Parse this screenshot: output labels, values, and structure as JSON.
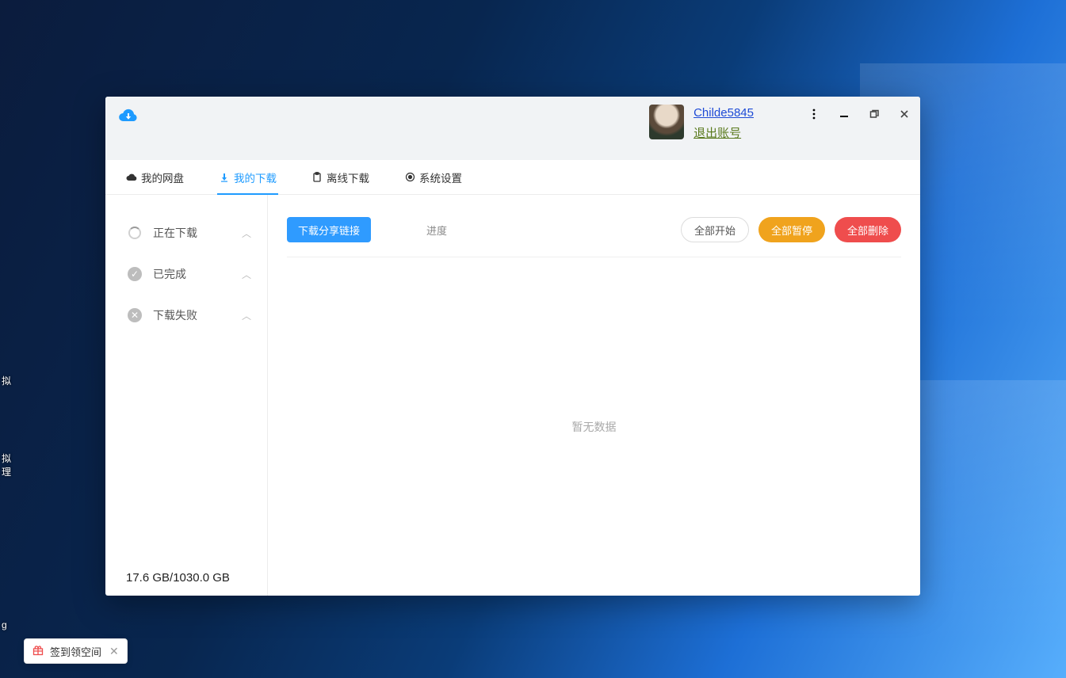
{
  "user": {
    "name": "Childe5845",
    "logout_label": "退出账号"
  },
  "tabs": {
    "disk": "我的网盘",
    "dl": "我的下载",
    "offline": "离线下载",
    "settings": "系统设置"
  },
  "side": {
    "downloading": "正在下载",
    "done": "已完成",
    "failed": "下载失败"
  },
  "toolbar": {
    "download_share": "下载分享链接",
    "progress": "进度",
    "start_all": "全部开始",
    "pause_all": "全部暂停",
    "delete_all": "全部删除"
  },
  "empty_text": "暂无数据",
  "storage_text": "17.6 GB/1030.0 GB",
  "toast": {
    "text": "签到领空间"
  },
  "edge_labels": {
    "a": "拟",
    "b": "拟\n理",
    "c": "g"
  }
}
